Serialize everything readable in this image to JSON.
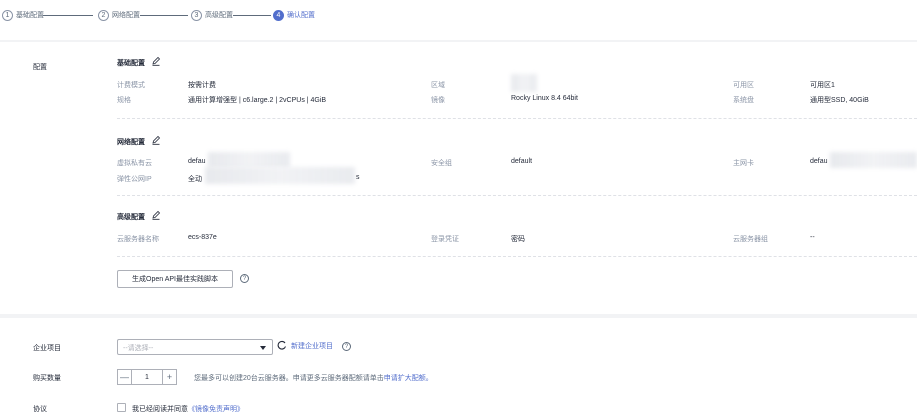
{
  "steps": [
    {
      "num": "1",
      "label": "基础配置"
    },
    {
      "num": "2",
      "label": "网络配置"
    },
    {
      "num": "3",
      "label": "高级配置"
    },
    {
      "num": "4",
      "label": "确认配置"
    }
  ],
  "config": {
    "section_label": "配置",
    "basic": {
      "title": "基础配置",
      "billing_label": "计费模式",
      "billing_value": "按需计费",
      "region_label": "区域",
      "az_label": "可用区",
      "az_value": "可用区1",
      "flavor_label": "规格",
      "flavor_value": "通用计算增强型 | c6.large.2 | 2vCPUs | 4GiB",
      "image_label": "镜像",
      "image_value": "Rocky Linux 8.4 64bit",
      "disk_label": "系统盘",
      "disk_value": "通用型SSD, 40GiB"
    },
    "network": {
      "title": "网络配置",
      "vpc_label": "虚拟私有云",
      "vpc_value": "defau",
      "sg_label": "安全组",
      "sg_value": "default",
      "nic_label": "主网卡",
      "nic_value": "defau",
      "eip_label": "弹性公网IP",
      "eip_value": "全动",
      "eip_suffix": "s"
    },
    "advanced": {
      "title": "高级配置",
      "name_label": "云服务器名称",
      "name_value": "ecs-837e",
      "cred_label": "登录凭证",
      "cred_value": "密码",
      "group_label": "云服务器组",
      "group_value": "--"
    },
    "api_button": "生成Open API最佳实践脚本"
  },
  "bottom": {
    "enterprise_label": "企业项目",
    "enterprise_placeholder": "--请选择--",
    "new_project_link": "新建企业项目",
    "qty_label": "购买数量",
    "qty_value": "1",
    "qty_minus": "—",
    "qty_plus": "+",
    "qty_note": "您最多可以创建20台云服务器。申请更多云服务器配额请单击",
    "qty_link": "申请扩大配额。",
    "agreement_label": "协议",
    "agreement_text": "我已经阅读并同意",
    "agreement_link": "《镜像免责声明》"
  },
  "colors": {
    "accent": "#526ecc",
    "text": "#252b3a",
    "muted": "#8a94a6",
    "background": "#f2f3f5"
  },
  "icons": {
    "edit": "edit-icon",
    "help": "help-icon",
    "refresh": "refresh-icon",
    "dropdown": "chevron-down-icon"
  }
}
